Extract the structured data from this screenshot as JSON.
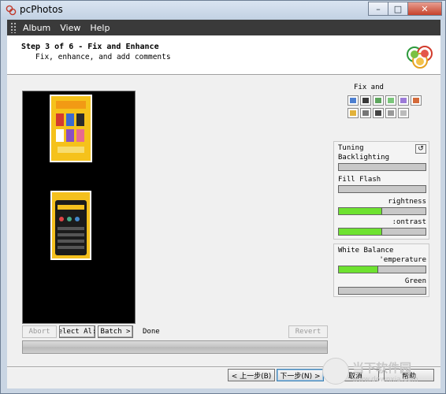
{
  "window": {
    "title": "pcPhotos"
  },
  "menu": {
    "items": [
      "Album",
      "View",
      "Help"
    ]
  },
  "header": {
    "title": "Step 3 of 6 - Fix and Enhance",
    "subtitle": "Fix, enhance, and add comments"
  },
  "controls": {
    "abort": "Abort",
    "select_all": "elect Al:",
    "batch": "Batch >",
    "status": "Done",
    "revert": "Revert"
  },
  "fix_panel": {
    "title": "Fix and",
    "tools": [
      "redeye-tool-icon",
      "crop-tool-icon",
      "rotate-tool-icon",
      "sharpen-tool-icon",
      "straighten-tool-icon",
      "resize-tool-icon",
      "color-tool-icon",
      "grayscale-tool-icon",
      "film-tool-icon",
      "eye-tool-icon",
      "copy-tool-icon"
    ]
  },
  "tuning": {
    "title": "Tuning",
    "backlighting": {
      "label": "Backlighting",
      "level": 0
    },
    "fill_flash": {
      "label": "Fill Flash",
      "level": 0
    },
    "brightness": {
      "label": "rightness",
      "level": 0.5
    },
    "contrast": {
      "label": ":ontrast",
      "level": 0.5
    }
  },
  "white_balance": {
    "title": "White Balance",
    "temperature": {
      "label": "'emperature",
      "level": 0.45
    },
    "green": {
      "label": "Green",
      "level": 0
    }
  },
  "navigation": {
    "back": "< 上一步(B)",
    "next": "下一步(N) >",
    "cancel": "取消",
    "help": "帮助"
  },
  "watermark": {
    "title": "当下软件园",
    "url": "www.downxia.com"
  },
  "colors": {
    "slider_fill": "#6ee230",
    "preview_bg": "#000000",
    "menubar_bg": "#3a3a3a"
  }
}
